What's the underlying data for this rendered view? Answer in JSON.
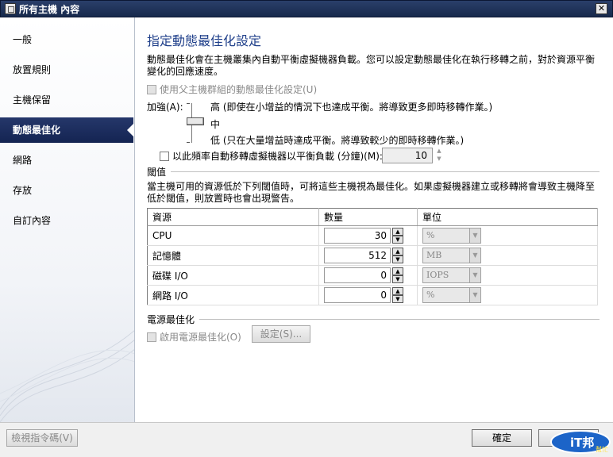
{
  "window": {
    "title": "所有主機 內容",
    "close_glyph": "✕"
  },
  "sidebar": {
    "items": [
      {
        "label": "一般"
      },
      {
        "label": "放置規則"
      },
      {
        "label": "主機保留"
      },
      {
        "label": "動態最佳化",
        "active": true
      },
      {
        "label": "網路"
      },
      {
        "label": "存放"
      },
      {
        "label": "自訂內容"
      }
    ]
  },
  "main": {
    "heading": "指定動態最佳化設定",
    "description": "動態最佳化會在主機叢集內自動平衡虛擬機器負載。您可以設定動態最佳化在執行移轉之前，對於資源平衡變化的回應速度。",
    "use_parent_label": "使用父主機群組的動態最佳化設定(U)",
    "aggressiveness_label": "加強(A):",
    "level_high": "高 (即使在小增益的情況下也達成平衡。將導致更多即時移轉作業。)",
    "level_medium": "中",
    "level_low": "低 (只在大量增益時達成平衡。將導致較少的即時移轉作業。)",
    "frequency_label": "以此頻率自動移轉虛擬機器以平衡負載 (分鐘)(M):",
    "frequency_value": "10",
    "threshold_title": "閾值",
    "threshold_desc": "當主機可用的資源低於下列閾值時，可將這些主機視為最佳化。如果虛擬機器建立或移轉將會導致主機降至低於閾值，則放置時也會出現警告。",
    "table": {
      "headers": [
        "資源",
        "數量",
        "單位"
      ],
      "rows": [
        {
          "resource": "CPU",
          "amount": "30",
          "unit": "%"
        },
        {
          "resource": "記憶體",
          "amount": "512",
          "unit": "MB"
        },
        {
          "resource": "磁碟 I/O",
          "amount": "0",
          "unit": "IOPS"
        },
        {
          "resource": "網路 I/O",
          "amount": "0",
          "unit": "%"
        }
      ]
    },
    "power_title": "電源最佳化",
    "power_enable_label": "啟用電源最佳化(O)",
    "power_settings_button": "設定(S)..."
  },
  "footer": {
    "view_script_button": "檢視指令碼(V)",
    "ok_button": "確定",
    "cancel_button": "取消",
    "logo_text": "iT邦",
    "logo_sub": "幫忙"
  },
  "colors": {
    "accent": "#1f3f8a",
    "selection": "#1a2d5e"
  }
}
